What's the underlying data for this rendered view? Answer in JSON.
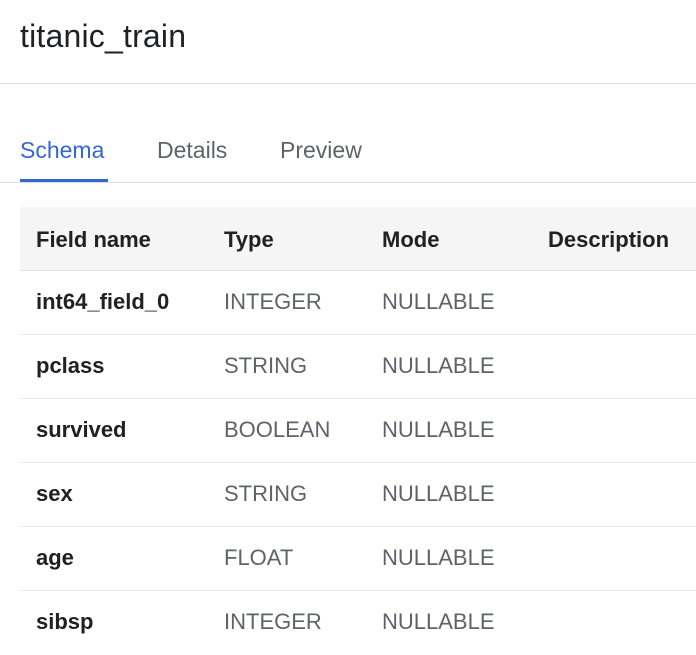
{
  "header": {
    "title": "titanic_train"
  },
  "tabs": [
    {
      "label": "Schema",
      "active": true
    },
    {
      "label": "Details",
      "active": false
    },
    {
      "label": "Preview",
      "active": false
    }
  ],
  "schema": {
    "columns": [
      "Field name",
      "Type",
      "Mode",
      "Description"
    ],
    "rows": [
      {
        "name": "int64_field_0",
        "type": "INTEGER",
        "mode": "NULLABLE",
        "description": ""
      },
      {
        "name": "pclass",
        "type": "STRING",
        "mode": "NULLABLE",
        "description": ""
      },
      {
        "name": "survived",
        "type": "BOOLEAN",
        "mode": "NULLABLE",
        "description": ""
      },
      {
        "name": "sex",
        "type": "STRING",
        "mode": "NULLABLE",
        "description": ""
      },
      {
        "name": "age",
        "type": "FLOAT",
        "mode": "NULLABLE",
        "description": ""
      },
      {
        "name": "sibsp",
        "type": "INTEGER",
        "mode": "NULLABLE",
        "description": ""
      }
    ]
  },
  "colors": {
    "accent": "#3367d6",
    "text_primary": "#202124",
    "text_secondary": "#5f6368",
    "header_bg": "#f5f5f5",
    "divider": "#dadce0"
  }
}
